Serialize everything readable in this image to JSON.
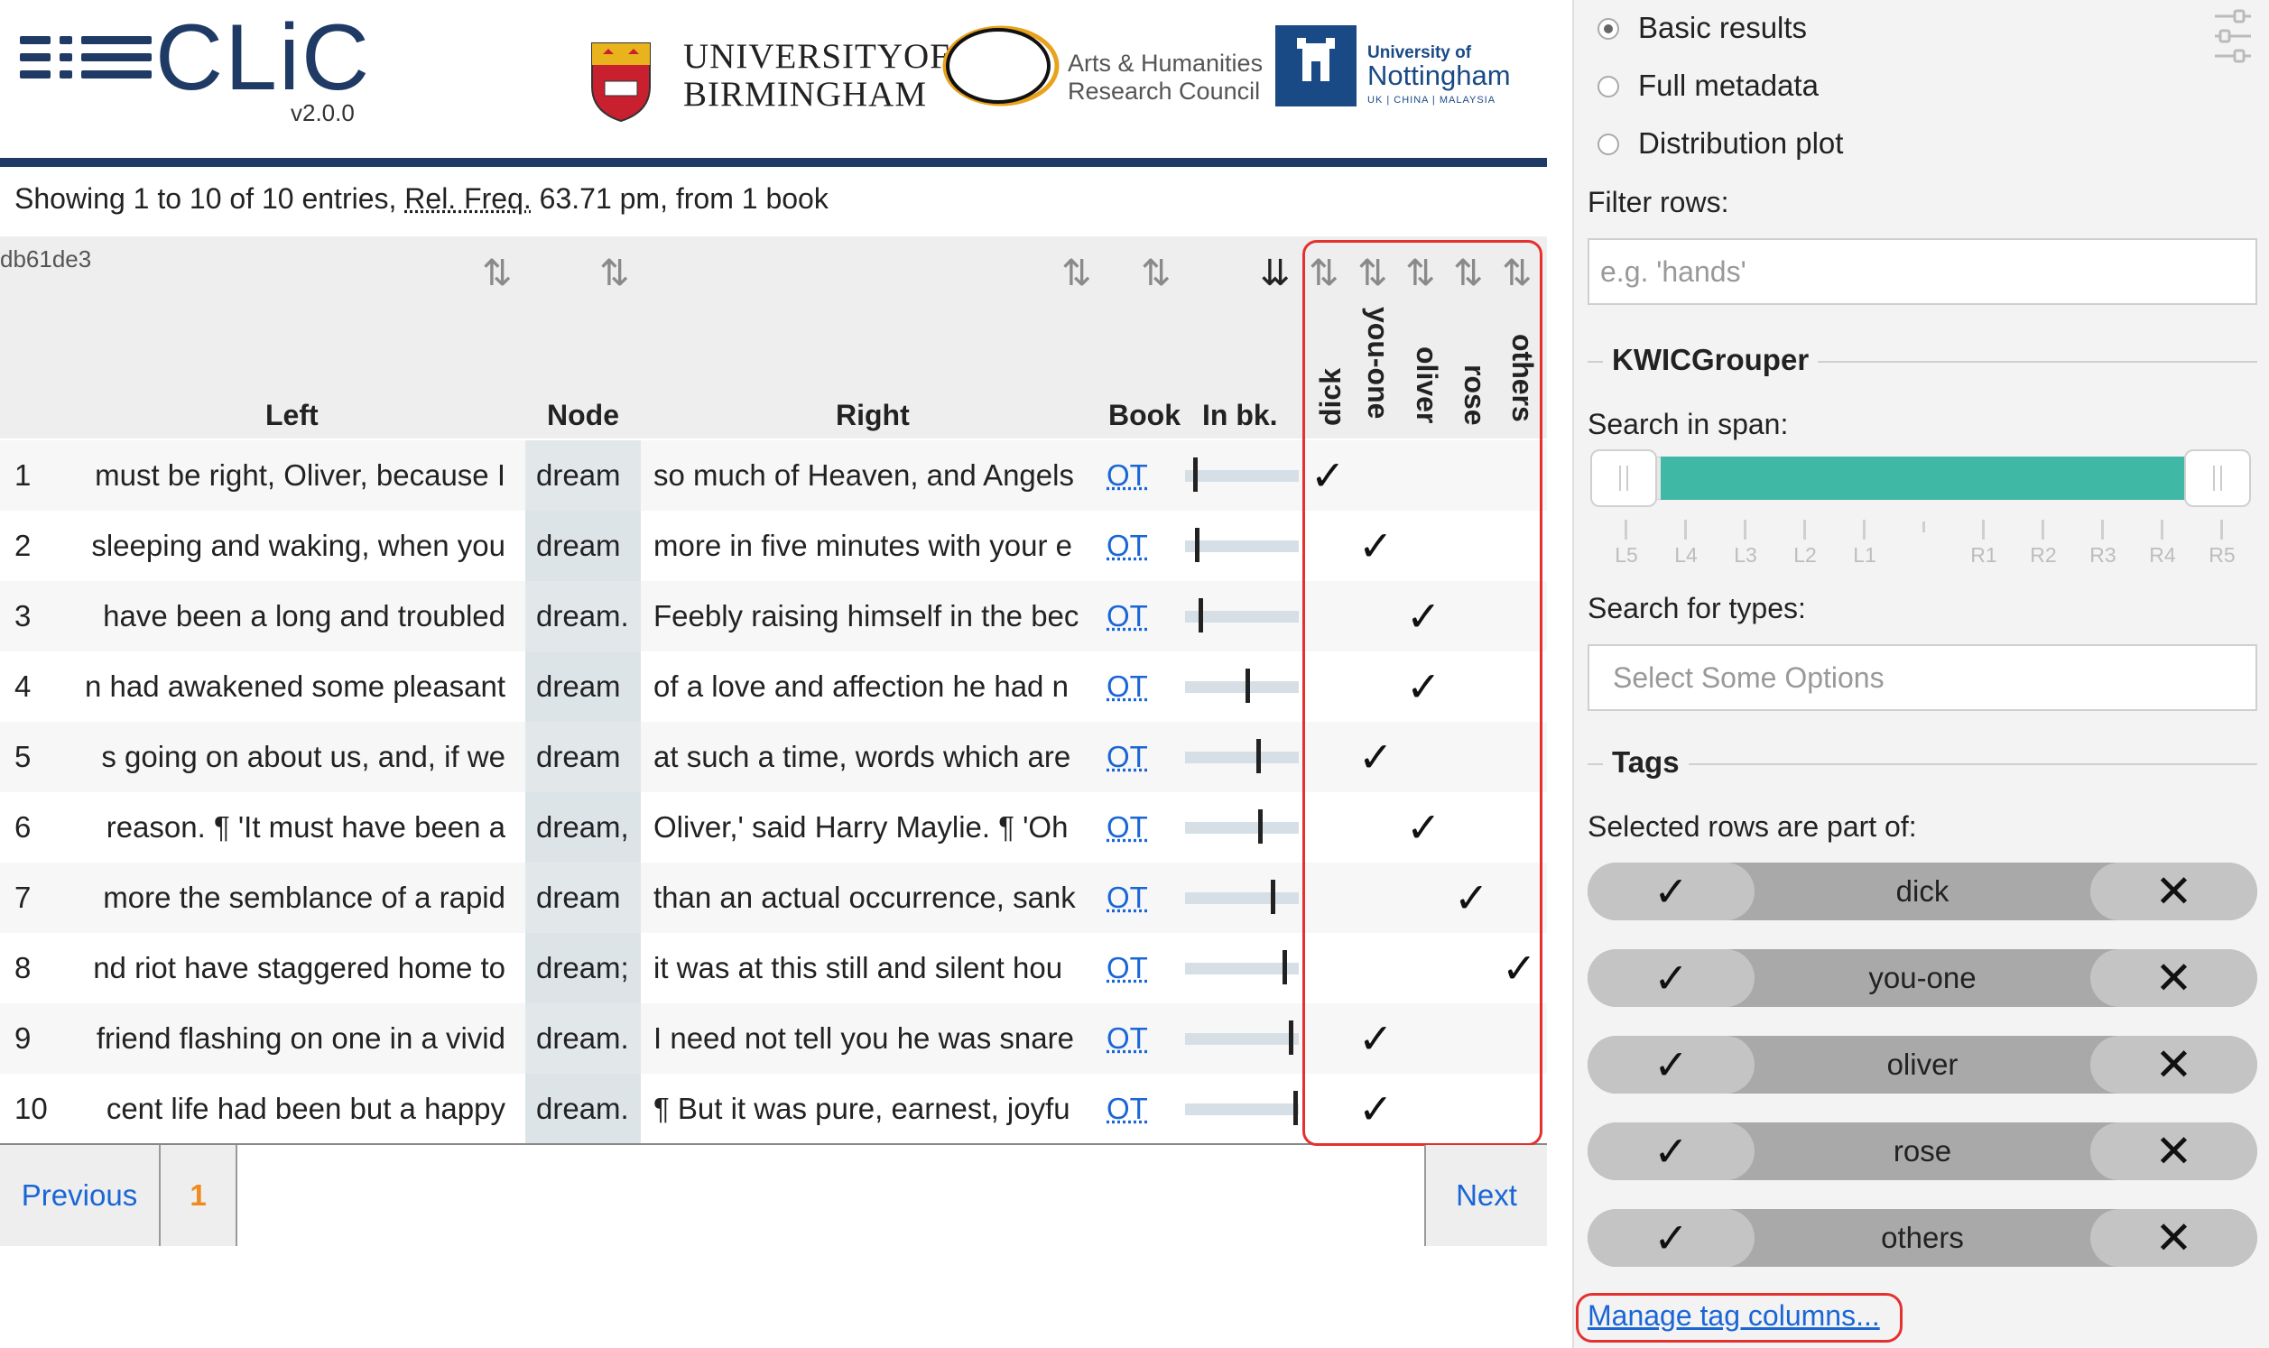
{
  "header": {
    "app_name": "CLiC",
    "version": "v2.0.0",
    "partner_uob_line1": "UNIVERSITYOF",
    "partner_uob_line2": "BIRMINGHAM",
    "partner_ahrc_line1": "Arts & Humanities",
    "partner_ahrc_line2": "Research Council",
    "partner_uon_small": "University of",
    "partner_uon_big": "Nottingham",
    "partner_uon_tiny": "UK | CHINA | MALAYSIA",
    "brand_color": "#1f3a64"
  },
  "results": {
    "info_prefix": "Showing 1 to 10 of 10 entries, ",
    "info_abbr": "Rel. Freq.",
    "info_suffix": " 63.71 pm, from 1 book",
    "hash": "db61de3",
    "columns": {
      "left": "Left",
      "node": "Node",
      "right": "Right",
      "book": "Book",
      "in_bk": "In bk.",
      "tags": [
        "dick",
        "you-one",
        "oliver",
        "rose",
        "others"
      ]
    },
    "rows": [
      {
        "num": "1",
        "left": "must be right, Oliver, because I",
        "node": "dream",
        "right": "so much of Heaven, and Angels",
        "book": "OT",
        "position": 0.07,
        "tag_index": 0
      },
      {
        "num": "2",
        "left": "sleeping and waking, when you",
        "node": "dream",
        "right": "more in five minutes with your e",
        "book": "OT",
        "position": 0.09,
        "tag_index": 1
      },
      {
        "num": "3",
        "left": "have been a long and troubled",
        "node": "dream.",
        "right": "Feebly raising himself in the bec",
        "book": "OT",
        "position": 0.12,
        "tag_index": 2
      },
      {
        "num": "4",
        "left": "n had awakened some pleasant",
        "node": "dream",
        "right": "of a love and affection he had n",
        "book": "OT",
        "position": 0.53,
        "tag_index": 2
      },
      {
        "num": "5",
        "left": "s going on about us, and, if we",
        "node": "dream",
        "right": "at such a time, words which are",
        "book": "OT",
        "position": 0.63,
        "tag_index": 1
      },
      {
        "num": "6",
        "left": "reason. ¶ 'It must have been a",
        "node": "dream,",
        "right": "Oliver,' said Harry Maylie. ¶ 'Oh",
        "book": "OT",
        "position": 0.64,
        "tag_index": 2
      },
      {
        "num": "7",
        "left": "more the semblance of a rapid",
        "node": "dream",
        "right": "than an actual occurrence, sank",
        "book": "OT",
        "position": 0.75,
        "tag_index": 3
      },
      {
        "num": "8",
        "left": "nd riot have staggered home to",
        "node": "dream;",
        "right": "it was at this still and silent hou",
        "book": "OT",
        "position": 0.86,
        "tag_index": 4
      },
      {
        "num": "9",
        "left": "friend flashing on one in a vivid",
        "node": "dream.",
        "right": "I need not tell you he was snare",
        "book": "OT",
        "position": 0.91,
        "tag_index": 1
      },
      {
        "num": "10",
        "left": "cent life had been but a happy",
        "node": "dream.",
        "right": "¶ But it was pure, earnest, joyfu",
        "book": "OT",
        "position": 0.95,
        "tag_index": 1
      }
    ],
    "check_glyph": "✓"
  },
  "pager": {
    "previous": "Previous",
    "current_page": "1",
    "next": "Next"
  },
  "sidebar": {
    "view_options": [
      {
        "label": "Basic results",
        "checked": true
      },
      {
        "label": "Full metadata",
        "checked": false
      },
      {
        "label": "Distribution plot",
        "checked": false
      }
    ],
    "filter_label": "Filter rows:",
    "filter_placeholder": "e.g. 'hands'",
    "kwic_legend": "KWICGrouper",
    "span_label": "Search in span:",
    "span_ticks": [
      "L5",
      "L4",
      "L3",
      "L2",
      "L1",
      "R1",
      "R2",
      "R3",
      "R4",
      "R5"
    ],
    "span_selected": {
      "from": "L5",
      "to": "R5"
    },
    "types_label": "Search for types:",
    "types_placeholder": "Select Some Options",
    "tags_legend": "Tags",
    "tags_subtitle": "Selected rows are part of:",
    "tags": [
      "dick",
      "you-one",
      "oliver",
      "rose",
      "others"
    ],
    "tag_check_glyph": "✓",
    "tag_remove_glyph": "✕",
    "manage_link": "Manage tag columns...",
    "accent_color": "#3fb8a6"
  }
}
